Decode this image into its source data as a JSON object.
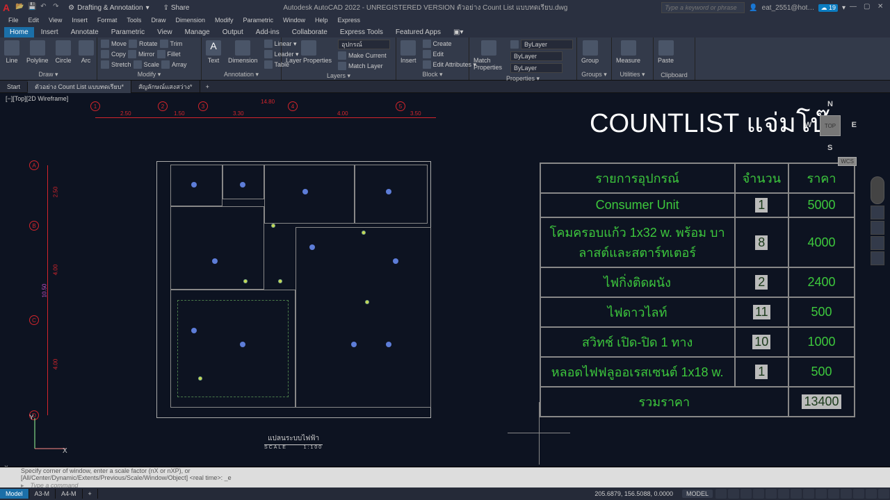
{
  "app": {
    "brand_letter": "A",
    "title": "Autodesk AutoCAD 2022 - UNREGISTERED VERSION   ตัวอย่าง Count List แบบทดเรียบ.dwg",
    "workspace": "Drafting & Annotation",
    "share": "Share",
    "search_placeholder": "Type a keyword or phrase",
    "user": "eat_2551@hot…",
    "badge": "19"
  },
  "menus": [
    "File",
    "Edit",
    "View",
    "Insert",
    "Format",
    "Tools",
    "Draw",
    "Dimension",
    "Modify",
    "Parametric",
    "Window",
    "Help",
    "Express"
  ],
  "ribbon_tabs": [
    "Home",
    "Insert",
    "Annotate",
    "Parametric",
    "View",
    "Manage",
    "Output",
    "Add-ins",
    "Collaborate",
    "Express Tools",
    "Featured Apps"
  ],
  "ribbon_active": "Home",
  "ribbon": {
    "draw": {
      "label": "Draw ▾",
      "items": [
        "Line",
        "Polyline",
        "Circle",
        "Arc"
      ]
    },
    "modify": {
      "label": "Modify ▾",
      "rows": [
        [
          "Move",
          "Rotate",
          "Trim"
        ],
        [
          "Copy",
          "Mirror",
          "Fillet"
        ],
        [
          "Stretch",
          "Scale",
          "Array"
        ]
      ]
    },
    "annotation": {
      "label": "Annotation ▾",
      "items": [
        "Text",
        "Dimension"
      ],
      "rows": [
        "Linear ▾",
        "Leader ▾",
        "Table"
      ]
    },
    "layers": {
      "label": "Layers ▾",
      "main": "Layer Properties",
      "combo": "อุปกรณ์"
    },
    "block": {
      "label": "Block ▾",
      "main": "Insert",
      "rows": [
        "Create",
        "Edit",
        "Edit Attributes ▾"
      ]
    },
    "properties": {
      "label": "Properties ▾",
      "main": "Match Properties",
      "rows": [
        "ByLayer",
        "ByLayer",
        "ByLayer"
      ]
    },
    "groups": {
      "label": "Groups ▾",
      "main": "Group"
    },
    "utilities": {
      "label": "Utilities ▾",
      "main": "Measure"
    },
    "clipboard": {
      "label": "Clipboard",
      "main": "Paste"
    },
    "match_layer": "Match Layer",
    "make_current": "Make Current"
  },
  "file_tabs": {
    "tabs": [
      "Start",
      "ตัวอย่าง Count List แบบทดเรียบ*",
      "สัญลักษณ์แสงสว่าง*"
    ],
    "active": 1
  },
  "view_label": "[−][Top][2D Wireframe]",
  "grid": {
    "cols": [
      {
        "n": "1"
      },
      {
        "n": "2"
      },
      {
        "n": "3"
      },
      {
        "n": "4"
      },
      {
        "n": "5"
      }
    ],
    "rows": [
      {
        "n": "A"
      },
      {
        "n": "B"
      },
      {
        "n": "C"
      },
      {
        "n": "D"
      }
    ],
    "col_dims": [
      "2.50",
      "1.50",
      "3.30",
      "4.00",
      "3.50"
    ],
    "col_total": "14.80",
    "row_dims": [
      "2.50",
      "4.00",
      "4.00"
    ],
    "row_total": "10.50"
  },
  "plan_title": {
    "name": "แปลนระบบไฟฟ้า",
    "scale_label": "SCALE",
    "scale": "1:100"
  },
  "countlist": {
    "heading": "COUNTLIST แจ่มโบ๊ะ",
    "headers": [
      "รายการอุปกรณ์",
      "จำนวน",
      "ราคา"
    ],
    "rows": [
      {
        "desc": "Consumer Unit",
        "qty": "1",
        "price": "5000"
      },
      {
        "desc": "โคมครอบแก้ว 1x32 w. พร้อม บาลาสต์และสตาร์ทเตอร์",
        "qty": "8",
        "price": "4000"
      },
      {
        "desc": "ไฟกิ่งติดผนัง",
        "qty": "2",
        "price": "2400"
      },
      {
        "desc": "ไฟดาวไลท์",
        "qty": "11",
        "price": "500"
      },
      {
        "desc": "สวิทช์ เปิด-ปิด 1 ทาง",
        "qty": "10",
        "price": "1000"
      },
      {
        "desc": "หลอดไฟฟลูออเรสเซนต์ 1x18 w.",
        "qty": "1",
        "price": "500"
      }
    ],
    "total_label": "รวมราคา",
    "total": "13400"
  },
  "cube": {
    "face": "TOP",
    "n": "N",
    "s": "S",
    "e": "E",
    "w": "W",
    "wcs": "WCS"
  },
  "ucs": {
    "y": "Y",
    "x": "X"
  },
  "cmd": {
    "h1": "Specify corner of window, enter a scale factor (nX or nXP), or",
    "h2": "[All/Center/Dynamic/Extents/Previous/Scale/Window/Object] <real time>: _e",
    "prompt": "Type a command"
  },
  "status": {
    "model_tabs": [
      "Model",
      "A3-M",
      "A4-M"
    ],
    "active": 0,
    "coords": "205.6879, 156.5088, 0.0000",
    "model": "MODEL"
  }
}
